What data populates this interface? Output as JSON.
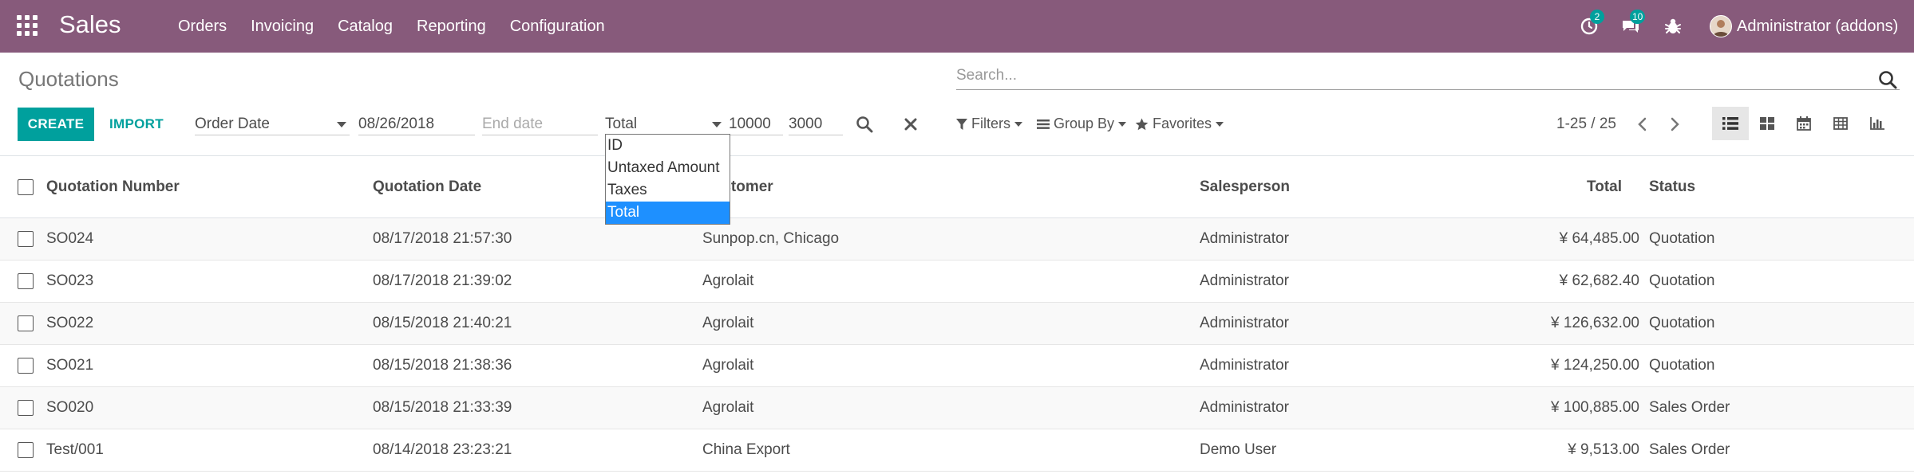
{
  "navbar": {
    "app_name": "Sales",
    "menu": [
      "Orders",
      "Invoicing",
      "Catalog",
      "Reporting",
      "Configuration"
    ],
    "activity_count": "2",
    "messages_count": "10",
    "user_name": "Administrator (addons)"
  },
  "control_panel": {
    "breadcrumb": "Quotations",
    "search_placeholder": "Search...",
    "create_label": "CREATE",
    "import_label": "IMPORT",
    "date_field_select": "Order Date",
    "start_date": "08/26/2018",
    "end_date_placeholder": "End date",
    "amount_field_select": "Total",
    "amount_from": "10000",
    "amount_to": "3000",
    "amount_field_options": [
      "ID",
      "Untaxed Amount",
      "Taxes",
      "Total"
    ],
    "amount_field_selected": "Total",
    "filters_label": "Filters",
    "groupby_label": "Group By",
    "favorites_label": "Favorites",
    "pager": "1-25 / 25"
  },
  "table": {
    "columns": {
      "number": "Quotation Number",
      "date": "Quotation Date",
      "customer": "Customer",
      "salesperson": "Salesperson",
      "total": "Total",
      "status": "Status"
    },
    "rows": [
      {
        "number": "SO024",
        "date": "08/17/2018 21:57:30",
        "customer": "Sunpop.cn, Chicago",
        "salesperson": "Administrator",
        "total": "¥ 64,485.00",
        "status": "Quotation"
      },
      {
        "number": "SO023",
        "date": "08/17/2018 21:39:02",
        "customer": "Agrolait",
        "salesperson": "Administrator",
        "total": "¥ 62,682.40",
        "status": "Quotation"
      },
      {
        "number": "SO022",
        "date": "08/15/2018 21:40:21",
        "customer": "Agrolait",
        "salesperson": "Administrator",
        "total": "¥ 126,632.00",
        "status": "Quotation"
      },
      {
        "number": "SO021",
        "date": "08/15/2018 21:38:36",
        "customer": "Agrolait",
        "salesperson": "Administrator",
        "total": "¥ 124,250.00",
        "status": "Quotation"
      },
      {
        "number": "SO020",
        "date": "08/15/2018 21:33:39",
        "customer": "Agrolait",
        "salesperson": "Administrator",
        "total": "¥ 100,885.00",
        "status": "Sales Order"
      },
      {
        "number": "Test/001",
        "date": "08/14/2018 23:23:21",
        "customer": "China Export",
        "salesperson": "Demo User",
        "total": "¥ 9,513.00",
        "status": "Sales Order"
      }
    ]
  },
  "icons": {
    "apps": "apps-grid-icon",
    "activity": "clock-icon",
    "messages": "chat-icon",
    "debug": "bug-icon",
    "search": "search-icon",
    "clear": "close-icon",
    "filters": "filter-icon",
    "groupby": "bars-icon",
    "favorites": "star-icon"
  },
  "colors": {
    "brand": "#875a7b",
    "primary": "#00a09d",
    "selected_option": "#1e90ff"
  }
}
